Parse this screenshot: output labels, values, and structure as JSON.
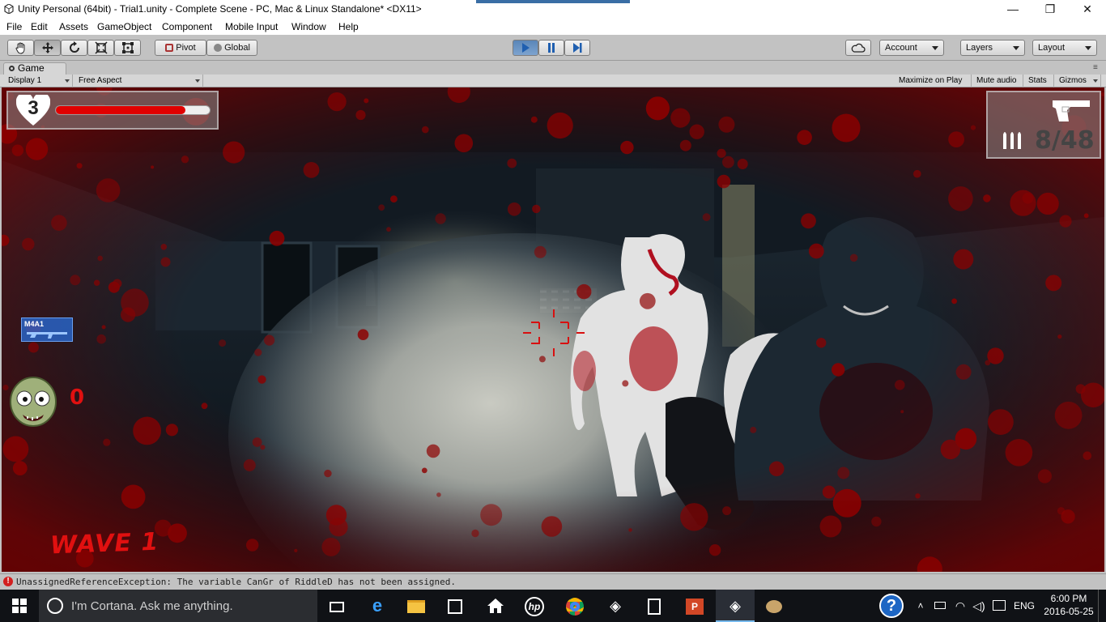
{
  "window": {
    "title": "Unity Personal (64bit) - Trial1.unity - Complete Scene - PC, Mac & Linux Standalone* <DX11>",
    "minimize_glyph": "—",
    "maximize_glyph": "❐",
    "close_glyph": "✕"
  },
  "menu": [
    "File",
    "Edit",
    "Assets",
    "GameObject",
    "Component",
    "Mobile Input",
    "Window",
    "Help"
  ],
  "toolbar": {
    "pivot_label": "Pivot",
    "global_label": "Global",
    "account_label": "Account",
    "layers_label": "Layers",
    "layout_label": "Layout"
  },
  "game_view": {
    "tab_label": "Game",
    "display_label": "Display 1",
    "aspect_label": "Free Aspect",
    "maximize_on_play": "Maximize on Play",
    "mute_audio": "Mute audio",
    "stats": "Stats",
    "gizmos": "Gizmos"
  },
  "hud": {
    "lives": "3",
    "health_fraction": 0.84,
    "ammo": "8/48",
    "weapon_label": "M4A1",
    "kills": "0",
    "wave": "WAVE 1"
  },
  "console": {
    "error_message": "UnassignedReferenceException: The variable CanGr of RiddleD has not been assigned."
  },
  "taskbar": {
    "search_placeholder": "I'm Cortana. Ask me anything.",
    "language": "ENG",
    "time": "6:00 PM",
    "date": "2016-05-25"
  },
  "colors": {
    "play_active": "#5a86b8",
    "health_bar": "#e00000",
    "blood": "#8b0000",
    "error_red": "#d21f1f"
  }
}
